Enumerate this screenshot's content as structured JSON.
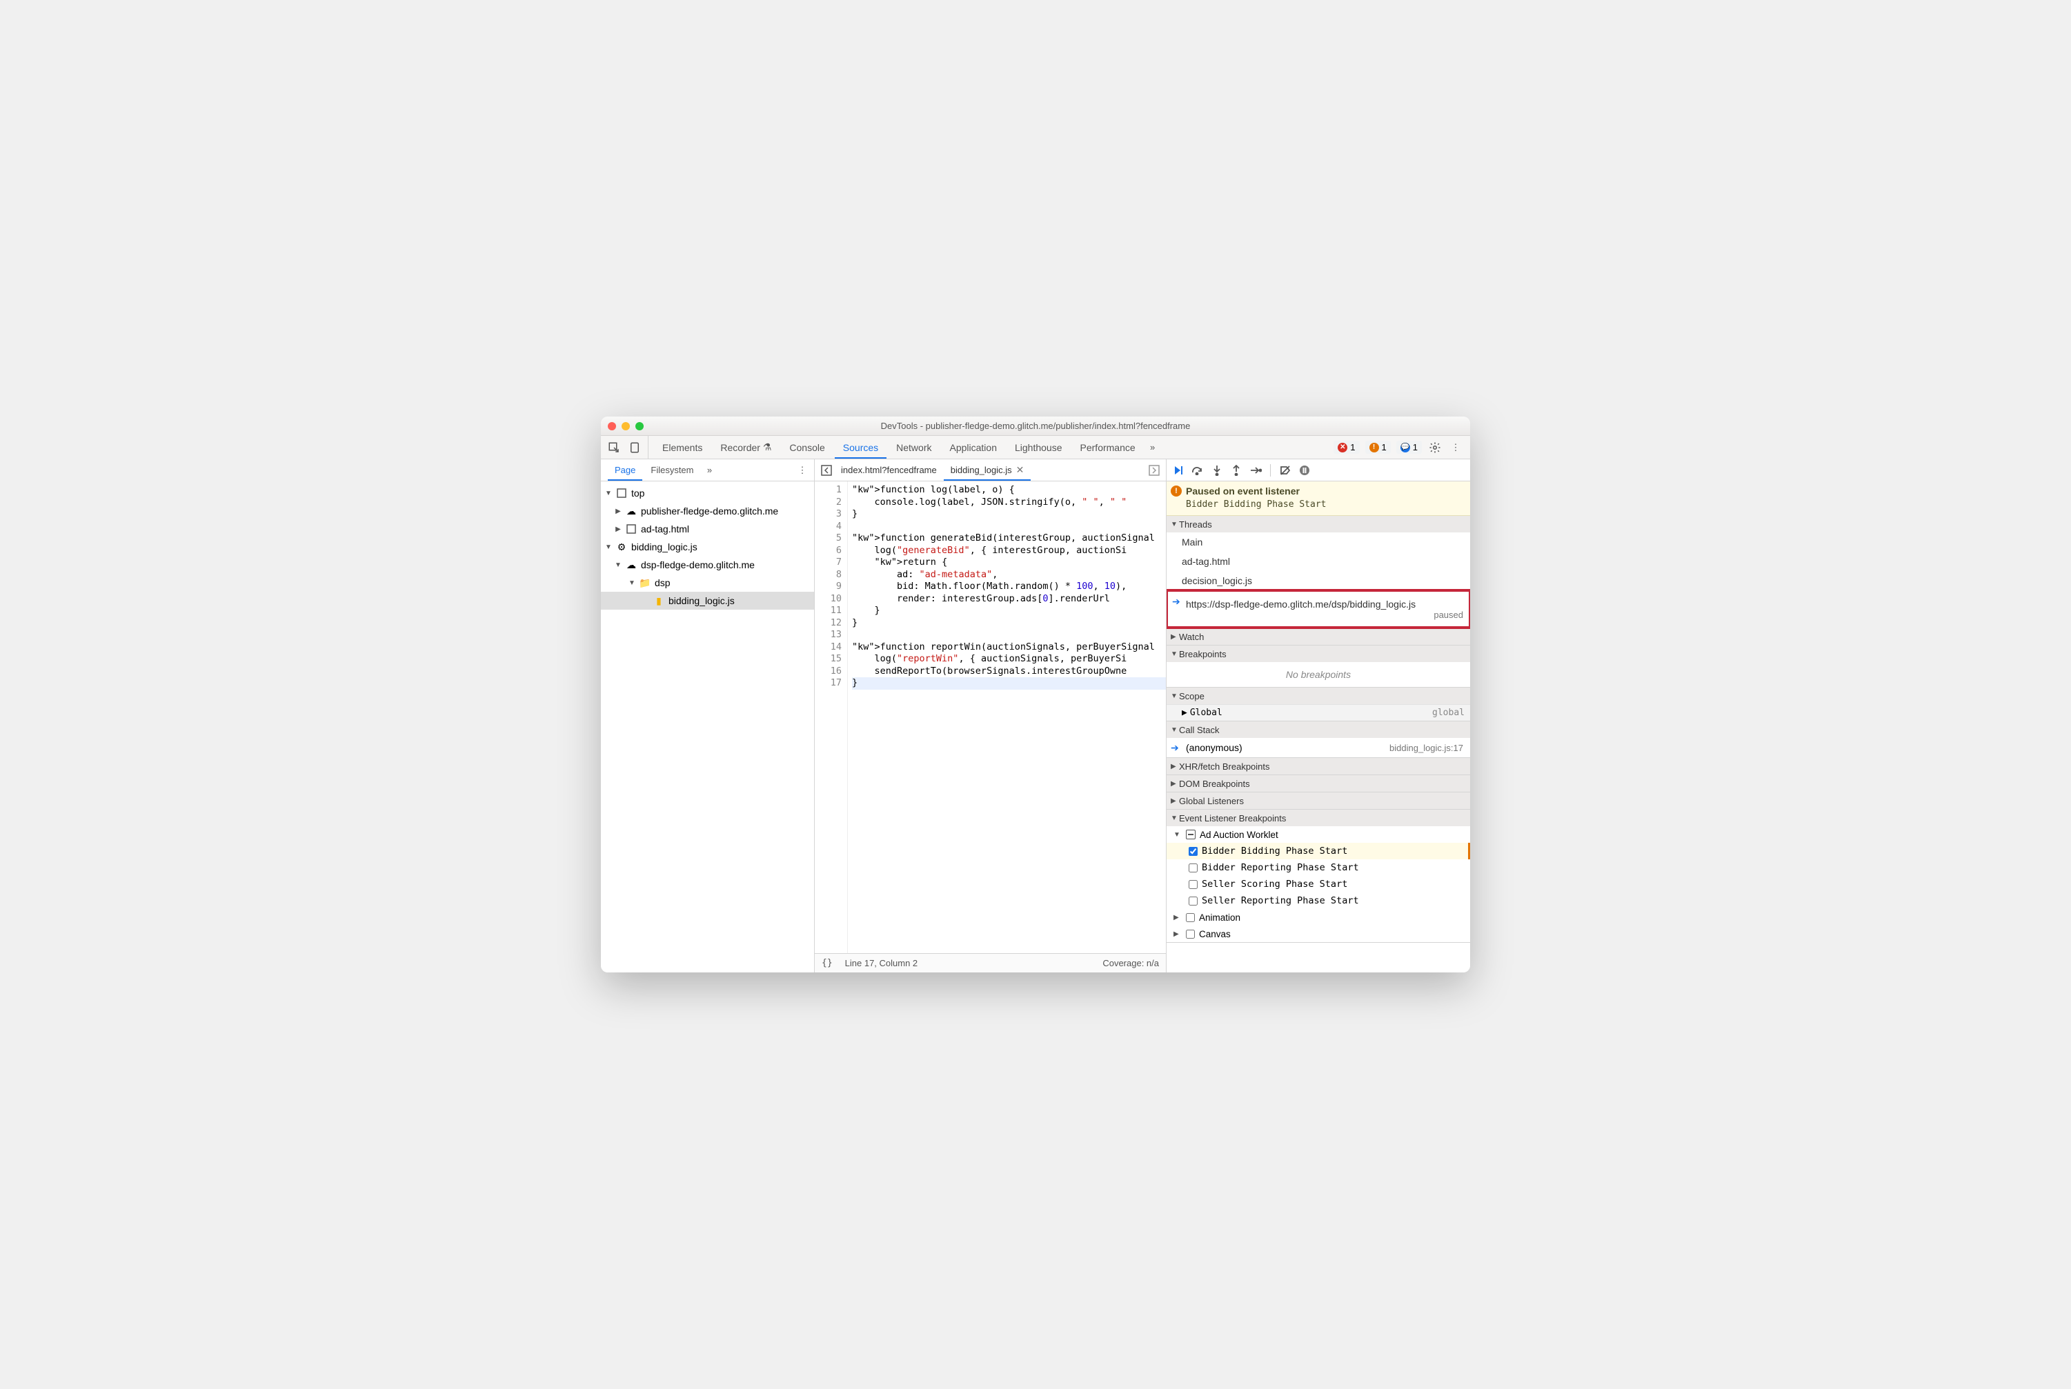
{
  "window": {
    "title": "DevTools - publisher-fledge-demo.glitch.me/publisher/index.html?fencedframe"
  },
  "toolbar": {
    "tabs": [
      "Elements",
      "Recorder",
      "Console",
      "Sources",
      "Network",
      "Application",
      "Lighthouse",
      "Performance"
    ],
    "active": "Sources",
    "errors": "1",
    "warnings": "1",
    "issues": "1"
  },
  "navigator": {
    "tabs": [
      "Page",
      "Filesystem"
    ],
    "active": "Page",
    "tree": {
      "top": "top",
      "pub_origin": "publisher-fledge-demo.glitch.me",
      "ad_tag": "ad-tag.html",
      "bidding_worklet": "bidding_logic.js",
      "dsp_origin": "dsp-fledge-demo.glitch.me",
      "dsp_folder": "dsp",
      "dsp_file": "bidding_logic.js"
    }
  },
  "editor": {
    "tabs": [
      {
        "label": "index.html?fencedframe",
        "active": false
      },
      {
        "label": "bidding_logic.js",
        "active": true
      }
    ],
    "lines": [
      "function log(label, o) {",
      "    console.log(label, JSON.stringify(o, \" \", \" \"",
      "}",
      "",
      "function generateBid(interestGroup, auctionSignal",
      "    log(\"generateBid\", { interestGroup, auctionSi",
      "    return {",
      "        ad: \"ad-metadata\",",
      "        bid: Math.floor(Math.random() * 100, 10),",
      "        render: interestGroup.ads[0].renderUrl",
      "    }",
      "}",
      "",
      "function reportWin(auctionSignals, perBuyerSignal",
      "    log(\"reportWin\", { auctionSignals, perBuyerSi",
      "    sendReportTo(browserSignals.interestGroupOwne",
      "}"
    ],
    "status": {
      "pos": "Line 17, Column 2",
      "coverage": "Coverage: n/a"
    }
  },
  "debugger": {
    "paused": {
      "title": "Paused on event listener",
      "sub": "Bidder Bidding Phase Start"
    },
    "sections": {
      "threads": {
        "label": "Threads",
        "items": [
          "Main",
          "ad-tag.html",
          "decision_logic.js"
        ],
        "current": {
          "url": "https://dsp-fledge-demo.glitch.me/dsp/bidding_logic.js",
          "state": "paused"
        }
      },
      "watch": "Watch",
      "breakpoints": {
        "label": "Breakpoints",
        "empty": "No breakpoints"
      },
      "scope": {
        "label": "Scope",
        "global_label": "Global",
        "global_val": "global"
      },
      "callstack": {
        "label": "Call Stack",
        "frame": "(anonymous)",
        "loc": "bidding_logic.js:17"
      },
      "xhr": "XHR/fetch Breakpoints",
      "dom": "DOM Breakpoints",
      "globallisteners": "Global Listeners",
      "evbp": {
        "label": "Event Listener Breakpoints",
        "ad_auction": "Ad Auction Worklet",
        "items": [
          {
            "label": "Bidder Bidding Phase Start",
            "checked": true
          },
          {
            "label": "Bidder Reporting Phase Start",
            "checked": false
          },
          {
            "label": "Seller Scoring Phase Start",
            "checked": false
          },
          {
            "label": "Seller Reporting Phase Start",
            "checked": false
          }
        ],
        "animation": "Animation",
        "canvas": "Canvas"
      }
    }
  }
}
